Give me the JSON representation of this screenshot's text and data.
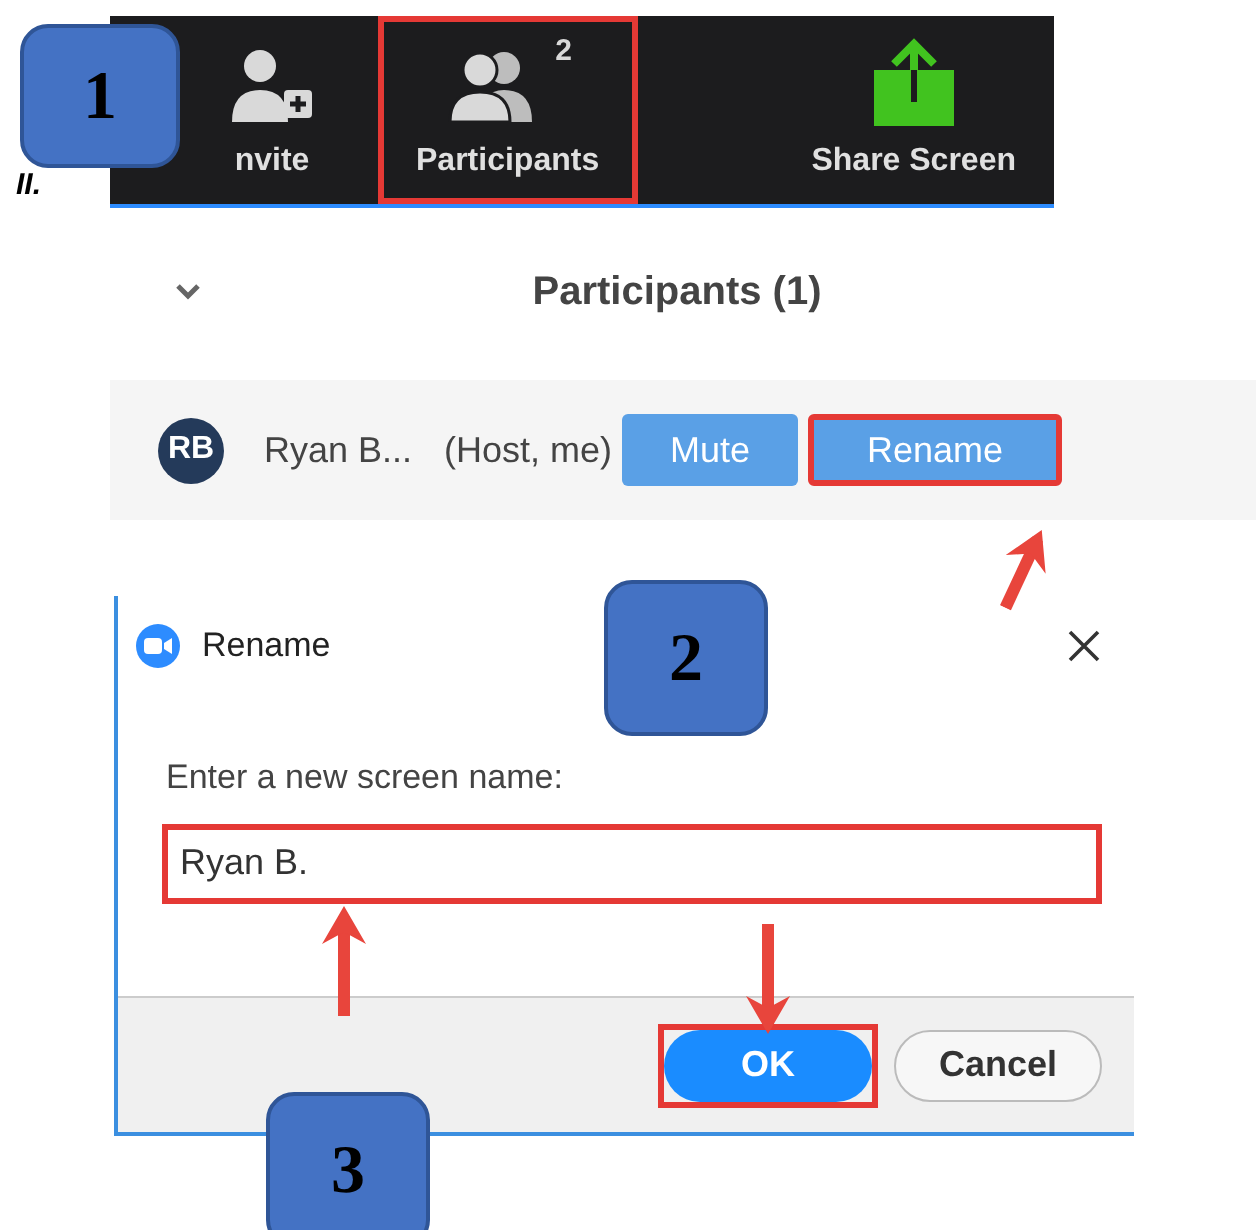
{
  "list_marker": "II.",
  "toolbar": {
    "items": [
      {
        "label": "nvite",
        "kind": "invite",
        "highlighted": false
      },
      {
        "label": "Participants",
        "kind": "participants",
        "badge": "2",
        "highlighted": true
      },
      {
        "label": "Share Screen",
        "kind": "share",
        "highlighted": false
      }
    ]
  },
  "participants_panel": {
    "title": "Participants (1)",
    "rows": [
      {
        "initials": "RB",
        "name": "Ryan B...",
        "role": "(Host, me)",
        "buttons": [
          {
            "label": "Mute",
            "highlighted": false
          },
          {
            "label": "Rename",
            "highlighted": true
          }
        ]
      }
    ]
  },
  "dialog": {
    "title": "Rename",
    "prompt": "Enter a new screen name:",
    "field": {
      "value": "Ryan B.",
      "highlighted": true
    },
    "buttons": [
      {
        "label": "OK",
        "kind": "primary",
        "highlighted": true
      },
      {
        "label": "Cancel",
        "kind": "secondary",
        "highlighted": false
      }
    ]
  },
  "step_badges": [
    "1",
    "2",
    "3"
  ]
}
